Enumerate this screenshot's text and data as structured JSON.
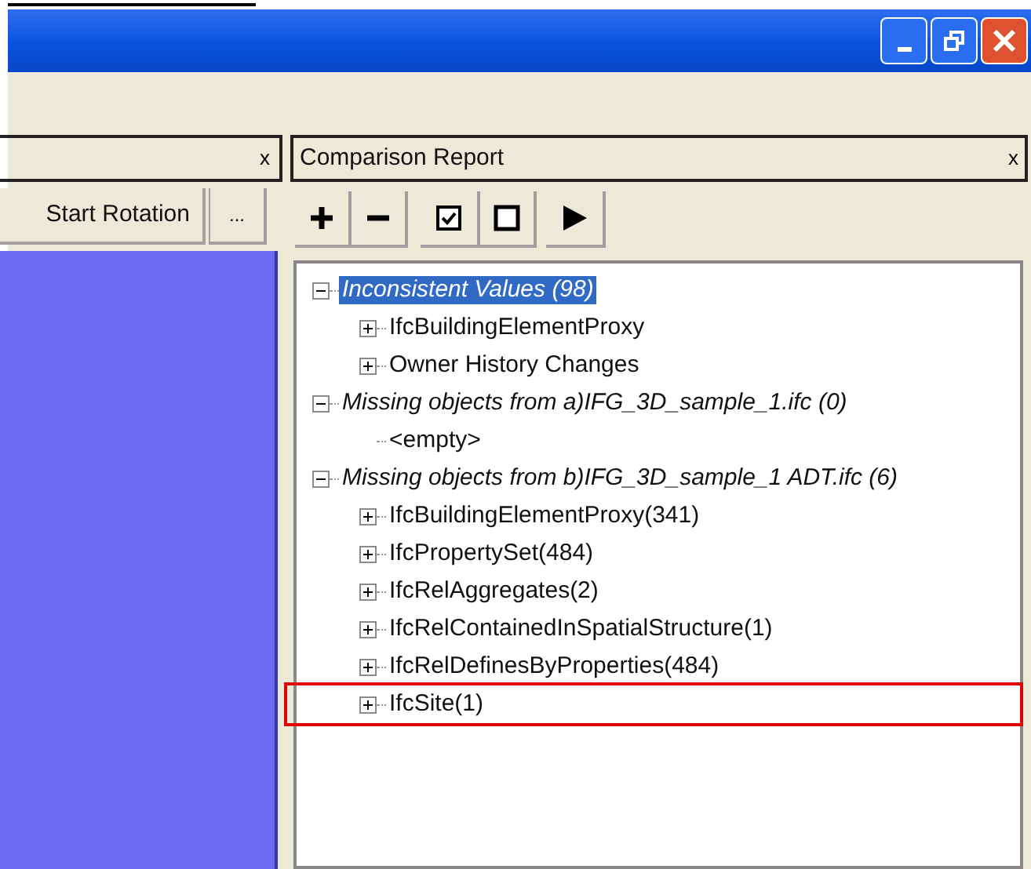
{
  "left_panel": {
    "close": "x",
    "buttons": [
      "Start Rotation",
      "..."
    ]
  },
  "report_panel": {
    "title": "Comparison Report",
    "close": "x"
  },
  "toolbar": [
    {
      "kind": "expand"
    },
    {
      "kind": "collapse"
    },
    {
      "kind": "check"
    },
    {
      "kind": "uncheck"
    },
    {
      "kind": "run"
    }
  ],
  "tree": [
    {
      "label": "Inconsistent Values (98)",
      "kind": "category",
      "expanded": true,
      "selected": true,
      "marked": false,
      "children": [
        {
          "label": "IfcBuildingElementProxy",
          "kind": "item",
          "expanded": false,
          "selected": false,
          "marked": false
        },
        {
          "label": "Owner History Changes",
          "kind": "item",
          "expanded": false,
          "selected": false,
          "marked": false
        }
      ]
    },
    {
      "label": "Missing objects from a)IFG_3D_sample_1.ifc (0)",
      "kind": "category",
      "expanded": true,
      "selected": false,
      "marked": false,
      "children": [
        {
          "label": "<empty>",
          "kind": "placeholder",
          "selected": false,
          "marked": false
        }
      ]
    },
    {
      "label": "Missing objects from b)IFG_3D_sample_1 ADT.ifc (6)",
      "kind": "category",
      "expanded": true,
      "selected": false,
      "marked": false,
      "children": [
        {
          "label": "IfcBuildingElementProxy(341)",
          "kind": "item",
          "expanded": false,
          "selected": false,
          "marked": false
        },
        {
          "label": "IfcPropertySet(484)",
          "kind": "item",
          "expanded": false,
          "selected": false,
          "marked": false
        },
        {
          "label": "IfcRelAggregates(2)",
          "kind": "item",
          "expanded": false,
          "selected": false,
          "marked": false
        },
        {
          "label": "IfcRelContainedInSpatialStructure(1)",
          "kind": "item",
          "expanded": false,
          "selected": false,
          "marked": false
        },
        {
          "label": "IfcRelDefinesByProperties(484)",
          "kind": "item",
          "expanded": false,
          "selected": false,
          "marked": false
        },
        {
          "label": "IfcSite(1)",
          "kind": "item",
          "expanded": false,
          "selected": false,
          "marked": true
        }
      ]
    }
  ]
}
